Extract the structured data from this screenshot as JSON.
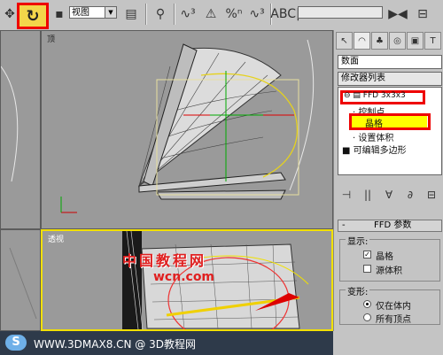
{
  "toolbar": {
    "view_select_value": "视图",
    "mini_buttons": [
      "↖",
      "⊗",
      "↻",
      "⊞",
      "≡",
      "▣",
      "⌖"
    ],
    "snap_buttons": [
      "∿³",
      "⚠",
      "%ⁿ",
      "∿³",
      "⁄",
      "ABC|",
      "≈",
      "▶◀",
      "⊟"
    ]
  },
  "viewports": {
    "top_label": "顶",
    "persp_label": "透视",
    "watermark_text": "中国教程网",
    "watermark_site": "wcn.com"
  },
  "command_panel": {
    "tabs": [
      "↖",
      "◠",
      "♣",
      "◎",
      "▣",
      "T"
    ],
    "object_name": "数面",
    "modifier_list": "修改器列表",
    "stack": [
      {
        "label": "FFD 3x3x3",
        "prefix": "⊖ ▤"
      },
      {
        "label": "控制点",
        "prefix": "·"
      },
      {
        "label": "晶格",
        "prefix": ""
      },
      {
        "label": "设置体积",
        "prefix": "·"
      },
      {
        "label": "可编辑多边形",
        "prefix": "■"
      }
    ],
    "stack_tools": [
      "⊣",
      "||",
      "∀",
      "∂",
      "⊟"
    ],
    "rollout_title": "FFD 参数",
    "rollout_toggle": "-",
    "display_group": "显示:",
    "lattice_checkbox": "晶格",
    "source_volume_checkbox": "源体积",
    "deform_group": "变形:",
    "only_in_volume": "仅在体内",
    "all_vertices": "所有顶点"
  },
  "bottom_bar": {
    "logo_glyph": "S",
    "text": "WWW.3DMAX8.CN @ 3D教程网"
  },
  "colors": {
    "highlight": "#e00000",
    "viewport_bg": "#9a9a9a",
    "lattice": "#f0e000",
    "selection": "#ffff00"
  }
}
